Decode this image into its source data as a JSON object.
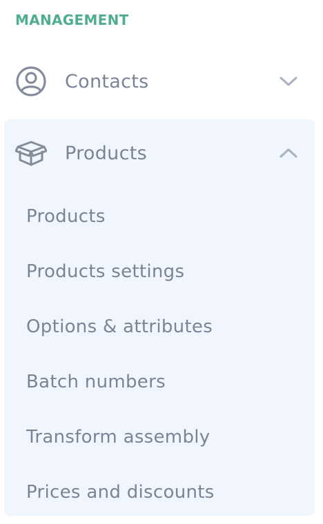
{
  "colors": {
    "heading": "#4fae8e",
    "text": "#7b8496",
    "icon": "#848c9c",
    "chevron": "#aab1bf",
    "panel_bg": "#f1f5fd"
  },
  "section": {
    "title": "MANAGEMENT"
  },
  "menu": {
    "contacts": {
      "label": "Contacts",
      "icon": "user-circle-icon",
      "expanded": false
    },
    "products": {
      "label": "Products",
      "icon": "box-icon",
      "expanded": true,
      "submenu": [
        {
          "label": "Products"
        },
        {
          "label": "Products settings"
        },
        {
          "label": "Options & attributes"
        },
        {
          "label": "Batch numbers"
        },
        {
          "label": "Transform assembly"
        },
        {
          "label": "Prices and discounts"
        }
      ]
    }
  }
}
